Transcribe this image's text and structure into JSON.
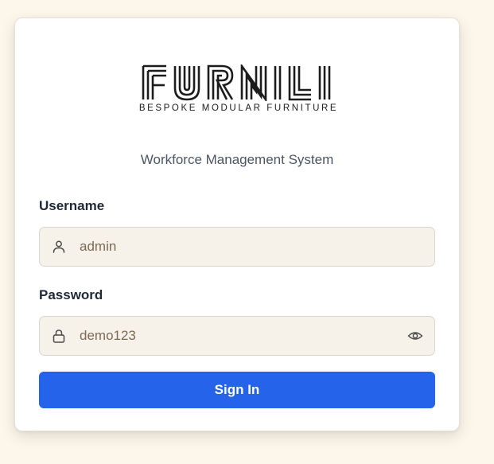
{
  "brand": {
    "name": "FURNILI",
    "tagline": "BESPOKE MODULAR FURNITURE"
  },
  "subtitle": "Workforce Management System",
  "username": {
    "label": "Username",
    "value": "admin",
    "icon": "user-icon"
  },
  "password": {
    "label": "Password",
    "value": "demo123",
    "icon": "lock-icon",
    "toggle_icon": "eye-icon"
  },
  "submit": {
    "label": "Sign In"
  },
  "colors": {
    "background": "#fdf6ea",
    "input_bg": "#f6f1e9",
    "accent": "#2563eb"
  }
}
